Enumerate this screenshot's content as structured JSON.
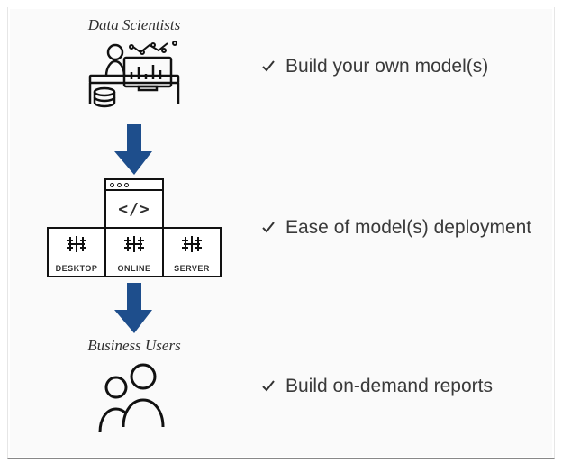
{
  "stage1": {
    "role": "Data Scientists",
    "benefit": "Build your own model(s)"
  },
  "stage2": {
    "code_symbol": "</>",
    "products": [
      "DESKTOP",
      "ONLINE",
      "SERVER"
    ],
    "benefit": "Ease of model(s) deployment"
  },
  "stage3": {
    "role": "Business Users",
    "benefit": "Build on-demand reports"
  },
  "colors": {
    "arrow": "#1E4E8C"
  }
}
